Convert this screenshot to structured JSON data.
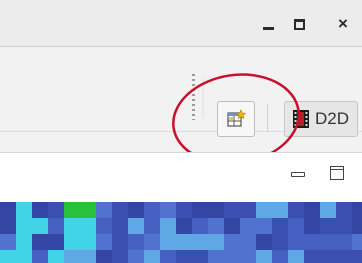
{
  "window": {
    "controls": {
      "minimize_icon": "minimize-icon",
      "maximize_icon": "maximize-icon",
      "close_glyph": "×"
    }
  },
  "toolbar": {
    "perspective_button": {
      "icon": "open-perspective-icon"
    },
    "d2d_button": {
      "icon": "d2d-perspective-icon",
      "label": "D2D"
    },
    "annotation_color": "#c8102e"
  },
  "view": {
    "minimize_icon": "view-minimize-icon",
    "maximize_icon": "view-maximize-icon"
  },
  "colors": {
    "titlebar": "#ececec",
    "toolbar_bg": "#f2f2f2",
    "map_dark_blue": "#3a4fb0",
    "map_light_blue": "#5fa8e6",
    "map_cyan": "#42d3e6",
    "map_green": "#27c23a"
  }
}
